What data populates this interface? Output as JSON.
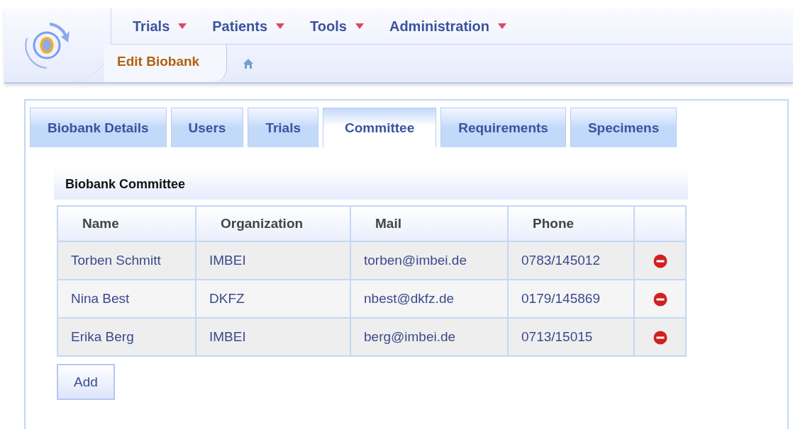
{
  "menu": [
    {
      "label": "Trials"
    },
    {
      "label": "Patients"
    },
    {
      "label": "Tools"
    },
    {
      "label": "Administration"
    }
  ],
  "breadcrumb": {
    "current": "Edit Biobank"
  },
  "tabs": [
    {
      "label": "Biobank Details",
      "selected": false
    },
    {
      "label": "Users",
      "selected": false
    },
    {
      "label": "Trials",
      "selected": false
    },
    {
      "label": "Committee",
      "selected": true
    },
    {
      "label": "Requirements",
      "selected": false
    },
    {
      "label": "Specimens",
      "selected": false
    }
  ],
  "section": {
    "title": "Biobank Committee"
  },
  "table": {
    "columns": [
      "Name",
      "Organization",
      "Mail",
      "Phone"
    ],
    "rows": [
      {
        "cells": [
          "Torben Schmitt",
          "IMBEI",
          "torben@imbei.de",
          "0783/145012"
        ]
      },
      {
        "cells": [
          "Nina Best",
          "DKFZ",
          "nbest@dkfz.de",
          "0179/145869"
        ]
      },
      {
        "cells": [
          "Erika Berg",
          "IMBEI",
          "berg@imbei.de",
          "0713/15015"
        ]
      }
    ]
  },
  "buttons": [
    "Add"
  ]
}
